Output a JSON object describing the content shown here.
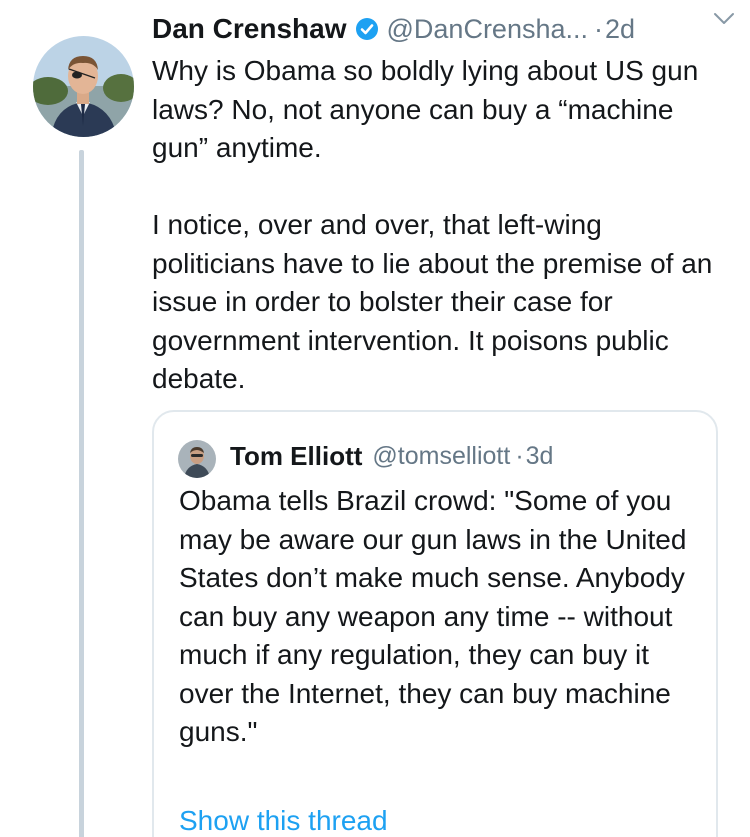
{
  "tweet": {
    "author_name": "Dan Crenshaw",
    "author_handle": "@DanCrensha...",
    "separator": "·",
    "time": "2d",
    "verified_icon": "verified-badge-icon",
    "menu_icon": "chevron-down-icon",
    "text": "Why is Obama so boldly lying about US gun laws? No, not anyone can buy a “machine gun” anytime.\n\nI notice, over and over, that left-wing politicians have to lie about the premise of an issue in order to bolster their case for government intervention. It poisons public debate."
  },
  "quoted_tweet": {
    "author_name": "Tom Elliott",
    "author_handle": "@tomselliott",
    "separator": "·",
    "time": "3d",
    "text": "Obama tells Brazil crowd: \"Some of you may be aware our gun laws in the United States don’t make much sense. Anybody can buy any weapon any time -- without much if any regulation, they can buy it over the Internet, they can buy machine guns.\"",
    "show_thread_label": "Show this thread"
  },
  "colors": {
    "text_primary": "#14171a",
    "text_secondary": "#657786",
    "link": "#1da1f2",
    "verified": "#1da1f2",
    "thread_line": "#c8d3dc",
    "border": "#e1e8ed"
  }
}
